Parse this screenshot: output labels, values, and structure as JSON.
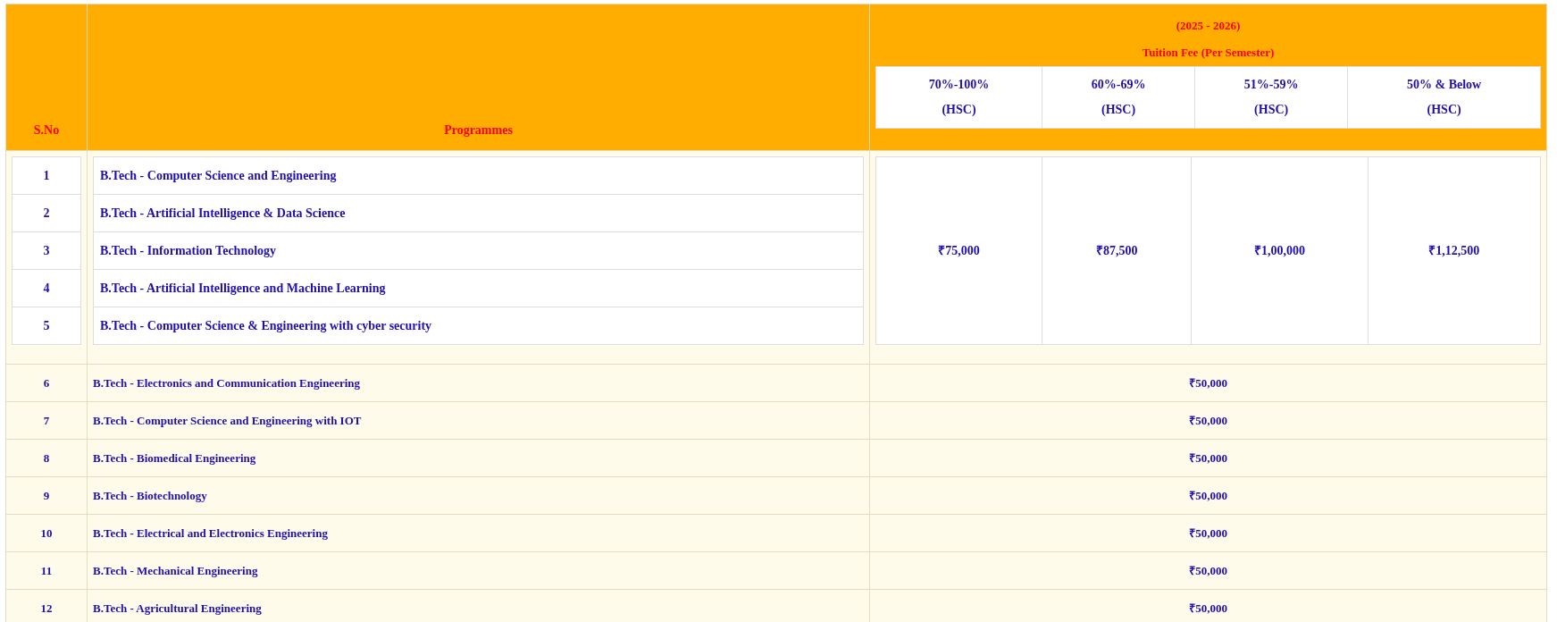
{
  "table": {
    "columns": {
      "serial": "S.No",
      "programme": "Programmes",
      "fee": {
        "year": "(2025 - 2026)",
        "title": "Tuition Fee (Per Semester)",
        "bands": [
          {
            "range": "70%-100%",
            "board": "(HSC)"
          },
          {
            "range": "60%-69%",
            "board": "(HSC)"
          },
          {
            "range": "51%-59%",
            "board": "(HSC)"
          },
          {
            "range": "50% & Below",
            "board": "(HSC)"
          }
        ]
      }
    },
    "grouped_rows": {
      "rows": [
        {
          "sno": "1",
          "programme": "B.Tech - Computer Science and Engineering"
        },
        {
          "sno": "2",
          "programme": "B.Tech - Artificial Intelligence & Data Science"
        },
        {
          "sno": "3",
          "programme": "B.Tech - Information Technology"
        },
        {
          "sno": "4",
          "programme": "B.Tech - Artificial Intelligence and Machine Learning"
        },
        {
          "sno": "5",
          "programme": "B.Tech - Computer Science & Engineering with cyber security"
        }
      ],
      "fees": [
        "₹75,000",
        "₹87,500",
        "₹1,00,000",
        "₹1,12,500"
      ]
    },
    "rows": [
      {
        "sno": "6",
        "programme": "B.Tech - Electronics and Communication Engineering",
        "fee": "₹50,000"
      },
      {
        "sno": "7",
        "programme": "B.Tech - Computer Science and Engineering with IOT",
        "fee": "₹50,000"
      },
      {
        "sno": "8",
        "programme": "B.Tech - Biomedical Engineering",
        "fee": "₹50,000"
      },
      {
        "sno": "9",
        "programme": "B.Tech - Biotechnology",
        "fee": "₹50,000"
      },
      {
        "sno": "10",
        "programme": "B.Tech - Electrical and Electronics Engineering",
        "fee": "₹50,000"
      },
      {
        "sno": "11",
        "programme": "B.Tech - Mechanical Engineering",
        "fee": "₹50,000"
      },
      {
        "sno": "12",
        "programme": "B.Tech - Agricultural Engineering",
        "fee": "₹50,000"
      }
    ]
  }
}
